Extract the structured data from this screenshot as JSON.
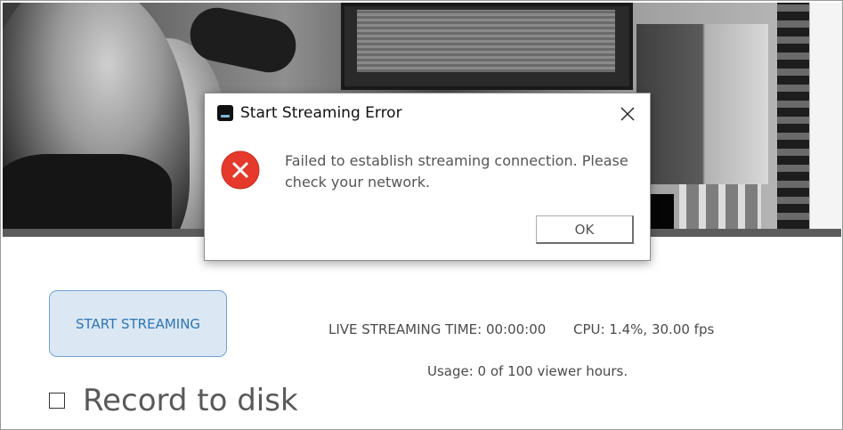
{
  "dialog": {
    "title": "Start Streaming Error",
    "message": "Failed to establish streaming connection. Please check your network.",
    "ok_label": "OK",
    "icon": "error-icon"
  },
  "controls": {
    "start_label": "START STREAMING",
    "live_time_label": "LIVE STREAMING TIME: 00:00:00",
    "cpu_label": "CPU: 1.4%, 30.00 fps",
    "usage_label": "Usage: 0 of 100 viewer hours.",
    "record_label": "Record to disk",
    "record_checked": false
  },
  "colors": {
    "accent": "#2d76b7",
    "button_bg": "#dbe7f3",
    "error_red": "#e53a2b"
  }
}
